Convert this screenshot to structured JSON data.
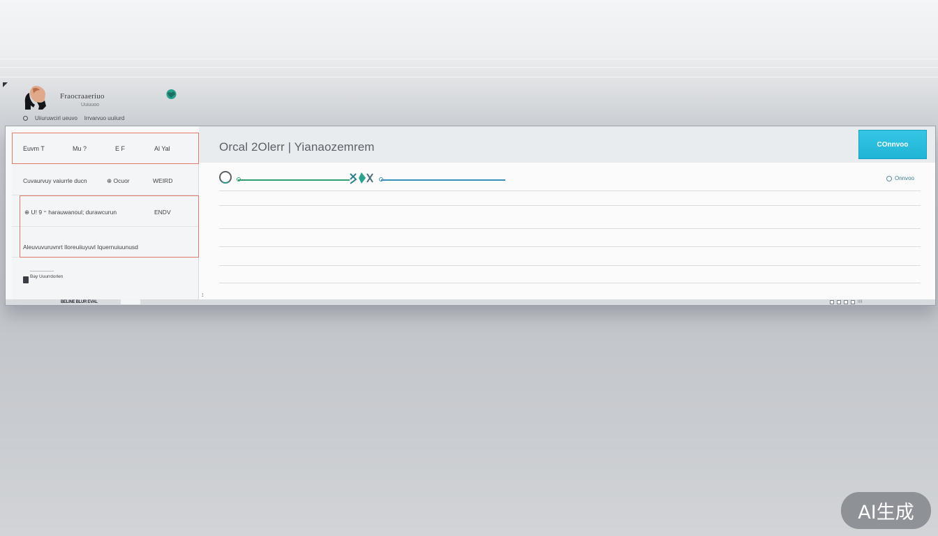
{
  "header": {
    "brand_title": "Fraocraaeriuo",
    "brand_subtitle": "Uuiuuoo",
    "meta_left": "Uiiuruwcirl ueuvo",
    "meta_right": "lrrvarvuo uuiiurd"
  },
  "sidebar": {
    "columns": [
      "Euvm T",
      "Mu ?",
      "E F",
      "Al Yal"
    ],
    "rows": [
      {
        "text": "Cuvaurvuy vaiurrle ducn",
        "mid": "⊕ Ocuor",
        "right": "WEIRD"
      },
      {
        "text": "⊕ U! 9 ⁼ harauwanoul; durawcurun",
        "mid": "",
        "right": "ENDV"
      },
      {
        "text": "Aleuvuvuruvnrt Iloreuiiuyuvl Iquernuiuunusd",
        "mid": "",
        "right": ""
      }
    ],
    "footnote": "Bay Uuurrdorlen"
  },
  "main": {
    "title": "Orcal 2Olerr | Yianaozemrem",
    "primary_button": "COnnvoo",
    "progress": {
      "middle_mark": "X",
      "status_text": "Onnvoo",
      "completed_fraction": 0.4
    }
  },
  "footer": {
    "left_text": "BELINE BLUR EVAL",
    "page_suffix": "IIII"
  },
  "watermark": "AI生成",
  "colors": {
    "accent_button": "#1fb4d6",
    "selection_outline": "#e07b6a",
    "progress_green": "#2f9e6e",
    "progress_blue": "#3a8fb8"
  }
}
